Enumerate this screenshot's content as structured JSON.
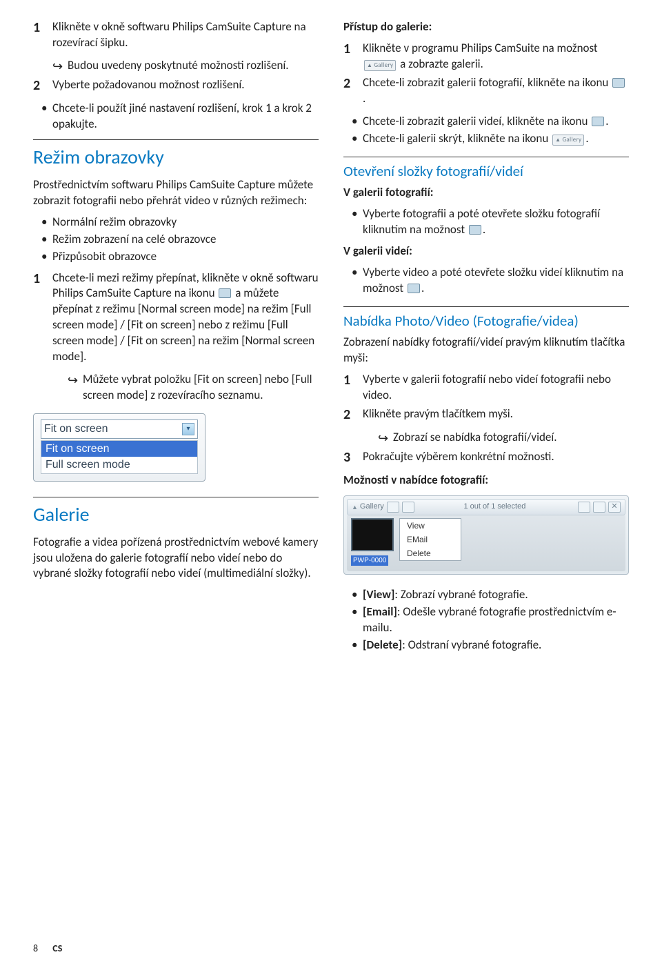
{
  "left": {
    "step1": {
      "num": "1",
      "text": "Klikněte v okně softwaru Philips CamSuite Capture na rozevírací šipku.",
      "arrow": "Budou uvedeny poskytnuté možnosti rozlišení."
    },
    "step2": {
      "num": "2",
      "text": "Vyberte požadovanou možnost rozlišení."
    },
    "bullet1": "Chcete-li použít jiné nastavení rozlišení, krok 1 a krok 2 opakujte.",
    "section2": "Režim obrazovky",
    "intro2": "Prostřednictvím softwaru Philips CamSuite Capture můžete zobrazit fotografii nebo přehrát video v různých režimech:",
    "modes": [
      "Normální režim obrazovky",
      "Režim zobrazení na celé obrazovce",
      "Přizpůsobit obrazovce"
    ],
    "step21": {
      "num": "1",
      "before": "Chcete-li mezi režimy přepínat, klikněte v okně softwaru Philips CamSuite Capture na ikonu ",
      "after": " a můžete přepínat z režimu [Normal screen mode] na režim [Full screen mode] / [Fit on screen] nebo z režimu [Full screen mode] / [Fit on screen] na režim [Normal screen mode].",
      "arrow": "Můžete vybrat položku [Fit on screen] nebo [Full screen mode] z rozevíracího seznamu."
    },
    "dropdown": {
      "selected": "Fit on screen",
      "opts": [
        "Fit on screen",
        "Full screen mode"
      ]
    },
    "section3": "Galerie",
    "galerie_p": "Fotografie a videa pořízená prostřednictvím webové kamery jsou uložena do galerie fotografií nebo videí nebo do vybrané složky fotografií nebo videí (multimediální složky)."
  },
  "right": {
    "access_title": "Přístup do galerie:",
    "a1": {
      "num": "1",
      "before": "Klikněte v programu Philips CamSuite na možnost ",
      "after": " a zobrazte galerii.",
      "galleryLabel": "Gallery"
    },
    "a2": {
      "num": "2",
      "l1_before": "Chcete-li zobrazit galerii fotografií, klikněte na ikonu ",
      "l1_after_dot": ".",
      "b1_before": "Chcete-li zobrazit galerii videí, klikněte na ikonu ",
      "b1_after": ".",
      "b2_before": "Chcete-li galerii skrýt, klikněte na ikonu ",
      "b2_after": ".",
      "gallery2": "Gallery"
    },
    "sub_open": "Otevření složky fotografií/videí",
    "photos_title": "V galerii fotografií:",
    "photos_b_before": "Vyberte fotografii a poté otevřete složku fotografií kliknutím na možnost ",
    "photos_b_dot": ".",
    "videos_title": "V galerii videí:",
    "videos_b_before": "Vyberte video a poté otevřete složku videí kliknutím na možnost ",
    "videos_b_dot": ".",
    "sub_menu": "Nabídka Photo/Video (Fotografie/videa)",
    "menu_intro": "Zobrazení nabídky fotografií/videí pravým kliknutím tlačítka myši:",
    "m1": {
      "num": "1",
      "text": "Vyberte v galerii fotografií nebo videí fotografii nebo video."
    },
    "m2": {
      "num": "2",
      "text": "Klikněte pravým tlačítkem myši.",
      "arrow": "Zobrazí se nabídka fotografií/videí."
    },
    "m3": {
      "num": "3",
      "text": "Pokračujte výběrem konkrétní možnosti."
    },
    "opts_title": "Možnosti v nabídce fotografií:",
    "bar": {
      "label": "Gallery",
      "status": "1 out of 1 selected",
      "thumb_label": "PWP-0000"
    },
    "ctx": [
      "View",
      "EMail",
      "Delete"
    ],
    "defs": [
      {
        "term": "[View]",
        "desc": ": Zobrazí vybrané fotografie."
      },
      {
        "term": "[Email]",
        "desc": ": Odešle vybrané fotografie prostřednictvím e-mailu."
      },
      {
        "term": "[Delete]",
        "desc": ": Odstraní vybrané fotografie."
      }
    ]
  },
  "footer": {
    "page": "8",
    "lang": "CS"
  }
}
